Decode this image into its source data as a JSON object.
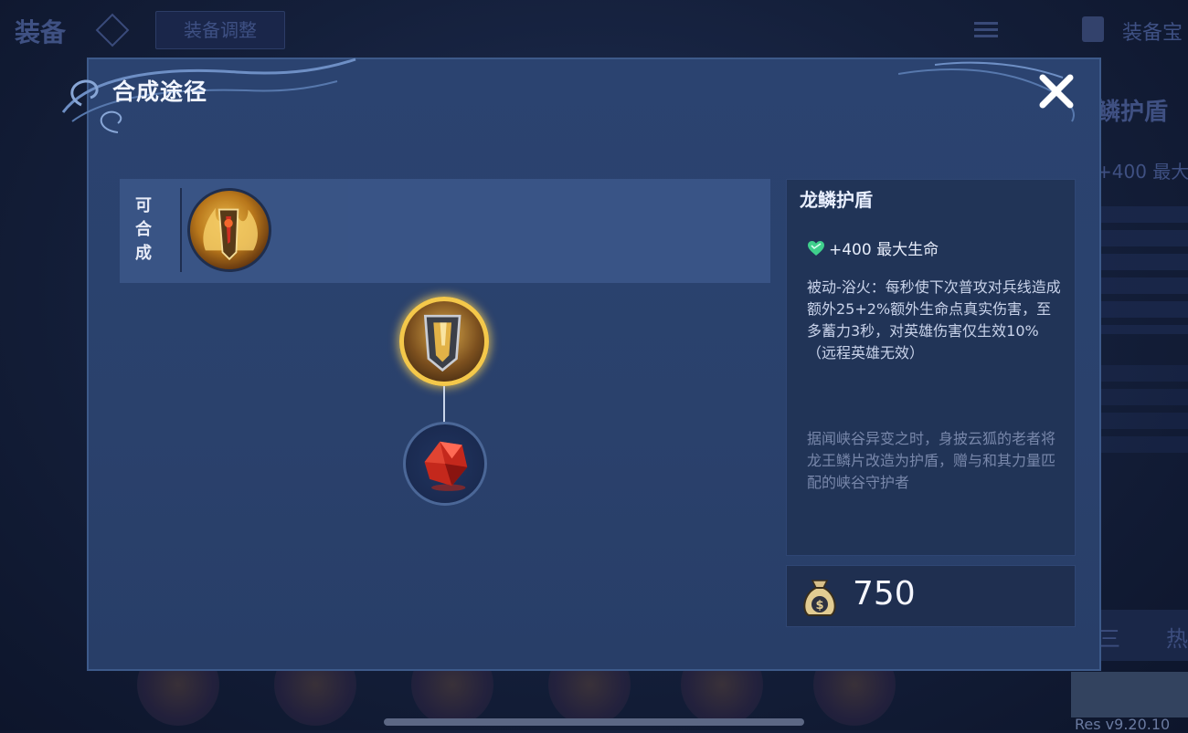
{
  "background": {
    "title": "装备",
    "adjust_button": "装备调整",
    "treasure_label": "装备宝",
    "right_item_name": "鳞护盾",
    "right_stat": "+400 最大",
    "tab_right": "热",
    "tab_left": "三",
    "version": "Res v9.20.10"
  },
  "dialog": {
    "title": "合成途径",
    "build_row_label": "可合成",
    "item_info": {
      "name": "龙鳞护盾",
      "stat": "+400 最大生命",
      "stat_icon": "heart-icon",
      "passive": "被动-浴火：每秒使下次普攻对兵线造成额外25+2%额外生命点真实伤害，至多蓄力3秒，对英雄伤害仅生效10%（远程英雄无效）",
      "lore": "据闻峡谷异变之时，身披云狐的老者将龙王鳞片改造为护盾，赠与和其力量匹配的峡谷守护者"
    },
    "price": "750",
    "price_icon": "coin-bag-icon"
  },
  "colors": {
    "accent_gold": "#f4c84a",
    "heart_green": "#3fd08c",
    "dialog_bg": "#2b4370"
  }
}
